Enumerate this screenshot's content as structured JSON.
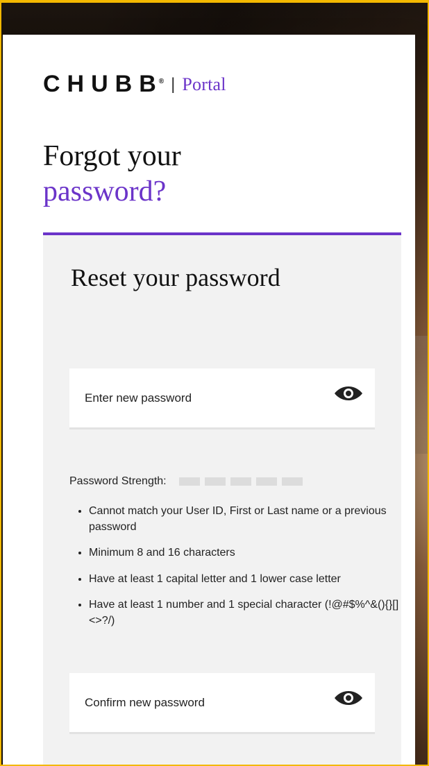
{
  "brand": {
    "logo_text": "CHUBB",
    "logo_mark": "®",
    "divider": "|",
    "portal": "Portal",
    "accent_color": "#6b34c9"
  },
  "page": {
    "title_line1": "Forgot your",
    "title_line2": "password?"
  },
  "panel": {
    "title": "Reset your password",
    "fields": {
      "new_password": {
        "placeholder": "Enter new password",
        "value": ""
      },
      "confirm_password": {
        "placeholder": "Confirm new password",
        "value": ""
      }
    },
    "strength": {
      "label": "Password Strength:",
      "level": 0,
      "segments": 5
    },
    "rules": [
      "Cannot match your User ID, First or Last name or a previous password",
      "Minimum 8 and 16 characters",
      "Have at least 1 capital letter and 1 lower case letter",
      "Have at least 1 number and 1 special character (!@#$%^&(){}[]<>?/)"
    ]
  },
  "icons": {
    "show_password": "eye-icon"
  }
}
